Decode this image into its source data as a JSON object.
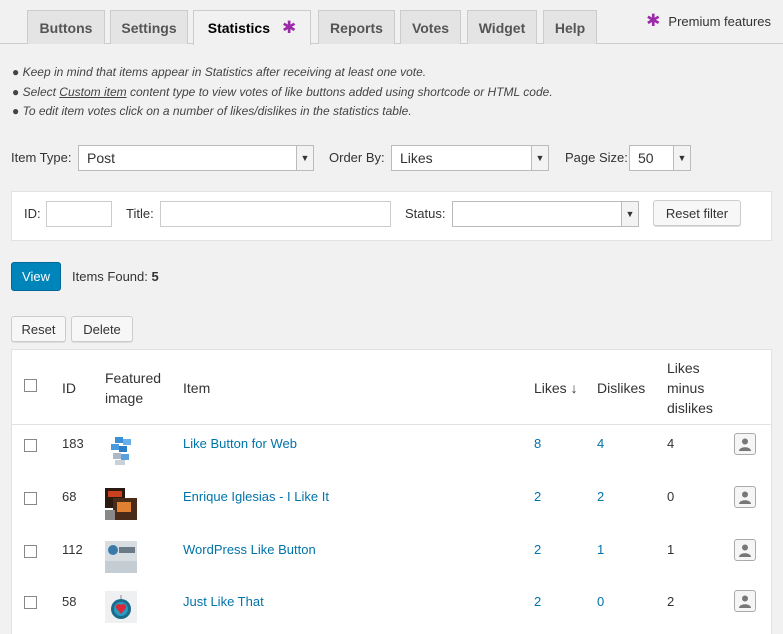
{
  "tabs": [
    {
      "label": "Buttons"
    },
    {
      "label": "Settings"
    },
    {
      "label": "Statistics",
      "active": true
    },
    {
      "label": "Reports"
    },
    {
      "label": "Votes"
    },
    {
      "label": "Widget"
    },
    {
      "label": "Help"
    }
  ],
  "premium_note": "Premium features",
  "notes": {
    "n1": "Keep in mind that items appear in Statistics after receiving at least one vote.",
    "n2_pre": "Select ",
    "n2_link": "Custom item",
    "n2_post": " content type to view votes of like buttons added using shortcode or HTML code.",
    "n3": "To edit item votes click on a number of likes/dislikes in the statistics table."
  },
  "filters": {
    "item_type_label": "Item Type:",
    "item_type_value": "Post",
    "order_by_label": "Order By:",
    "order_by_value": "Likes",
    "page_size_label": "Page Size:",
    "page_size_value": "50",
    "id_label": "ID:",
    "id_value": "",
    "title_label": "Title:",
    "title_value": "",
    "status_label": "Status:",
    "status_value": "",
    "reset_filter_label": "Reset filter"
  },
  "view_label": "View",
  "items_found_label": "Items Found:",
  "items_found_count": "5",
  "reset_label": "Reset",
  "delete_label": "Delete",
  "table": {
    "headers": {
      "id": "ID",
      "featured_1": "Featured",
      "featured_2": "image",
      "item": "Item",
      "likes": "Likes ↓",
      "dislikes": "Dislikes",
      "lmd_1": "Likes",
      "lmd_2": "minus",
      "lmd_3": "dislikes"
    },
    "rows": [
      {
        "id": "183",
        "item": "Like Button for Web",
        "likes": "8",
        "dislikes": "4",
        "diff": "4"
      },
      {
        "id": "68",
        "item": "Enrique Iglesias - I Like It",
        "likes": "2",
        "dislikes": "2",
        "diff": "0"
      },
      {
        "id": "112",
        "item": "WordPress Like Button",
        "likes": "2",
        "dislikes": "1",
        "diff": "1"
      },
      {
        "id": "58",
        "item": "Just Like That",
        "likes": "2",
        "dislikes": "0",
        "diff": "2"
      }
    ]
  },
  "colors": {
    "accent": "#0085ba",
    "link": "#0073aa",
    "premium_star": "#9b2aa8"
  }
}
